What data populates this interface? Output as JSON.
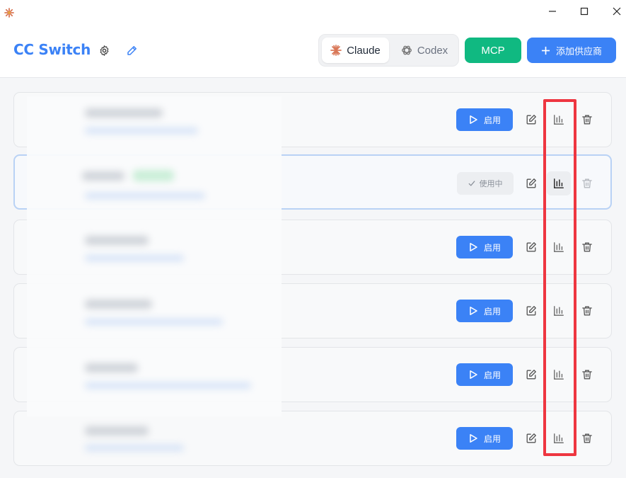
{
  "window": {
    "app_icon": "sunburst-logo-icon",
    "controls": [
      "minimize-icon",
      "maximize-icon",
      "close-icon"
    ]
  },
  "header": {
    "title": "CC Switch",
    "settings_icon": "gear-icon",
    "edit_icon": "pencil-icon",
    "tabs": [
      {
        "label": "Claude",
        "icon": "claude-sunburst-icon",
        "active": true
      },
      {
        "label": "Codex",
        "icon": "openai-knot-icon",
        "active": false
      }
    ],
    "mcp_label": "MCP",
    "add_label": "添加供应商",
    "colors": {
      "brand_blue": "#3b82f6",
      "mcp_green": "#10b981",
      "claude_orange": "#d97757"
    }
  },
  "providers": [
    {
      "status": "idle",
      "action_label": "启用"
    },
    {
      "status": "current",
      "action_label": "使用中"
    },
    {
      "status": "idle",
      "action_label": "启用"
    },
    {
      "status": "idle",
      "action_label": "启用"
    },
    {
      "status": "idle",
      "action_label": "启用"
    },
    {
      "status": "idle",
      "action_label": "启用"
    }
  ],
  "row_actions": [
    "edit-icon",
    "usage-chart-icon",
    "trash-icon"
  ],
  "annotation": {
    "color": "#ee3640",
    "target": "usage-chart-icon column"
  }
}
